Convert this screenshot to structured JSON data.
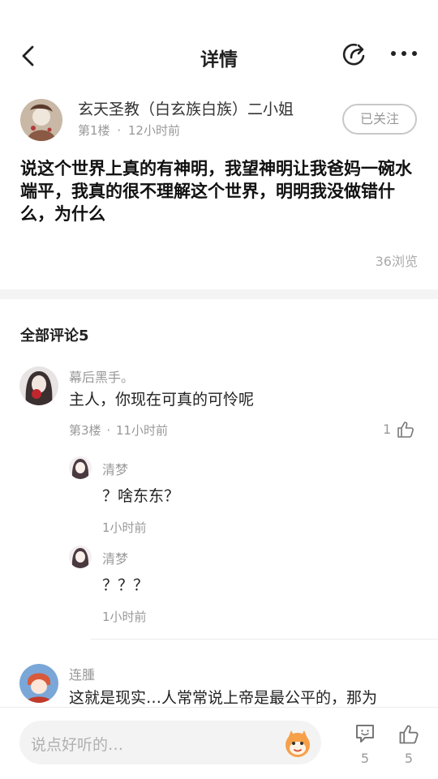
{
  "header": {
    "title": "详情",
    "back_icon": "chevron-left-icon",
    "share_icon": "share-icon",
    "more_icon": "more-icon"
  },
  "post": {
    "author": "玄天圣教（白玄族白族）二小姐",
    "floor": "第1楼",
    "separator": "·",
    "time": "12小时前",
    "follow_label": "已关注",
    "content": "说这个世界上真的有神明，我望神明让我爸妈一碗水端平，我真的很不理解这个世界，明明我没做错什么，为什么",
    "views": "36浏览"
  },
  "comments_header": "全部评论5",
  "comments": [
    {
      "name": "幕后黑手。",
      "text": "主人，你现在可真的可怜呢",
      "floor": "第3楼",
      "separator": "·",
      "time": "11小时前",
      "likes": "1",
      "replies": [
        {
          "name": "清梦",
          "text": "？啥东东？",
          "time": "1小时前"
        },
        {
          "name": "清梦",
          "text": "？？？",
          "time": "1小时前"
        }
      ]
    },
    {
      "name": "连腫",
      "text": "这就是现实…人常常说上帝是最公平的，那为"
    }
  ],
  "bottom_bar": {
    "placeholder": "说点好听的…",
    "comment_count": "5",
    "like_count": "5"
  },
  "colors": {
    "accent_red": "#e53935",
    "text_primary": "#222222",
    "text_secondary": "#999999"
  }
}
